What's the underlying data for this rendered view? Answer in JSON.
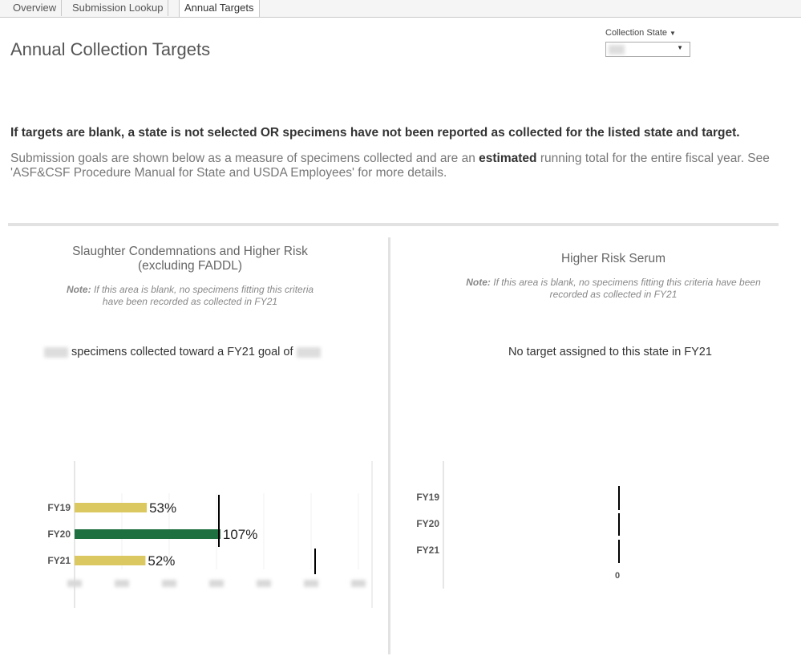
{
  "tabs": [
    {
      "label": "Overview"
    },
    {
      "label": "Submission Lookup"
    },
    {
      "label": "Annual Targets"
    }
  ],
  "page_title": "Annual Collection Targets",
  "filter": {
    "label": "Collection State",
    "value": ""
  },
  "notice": "If targets are blank, a state is not selected OR specimens have not been reported as collected for the listed state and target.",
  "description": {
    "before": "Submission goals are shown below as a measure of specimens collected and are an ",
    "emphasis": "estimated",
    "after": " running total for the entire fiscal year. See 'ASF&CSF Procedure Manual for State and USDA Employees' for more details."
  },
  "left_panel": {
    "title_line1": "Slaughter Condemnations and Higher Risk",
    "title_line2": "(excluding FADDL)",
    "note_label": "Note:",
    "note_line1": " If this area is blank, no specimens fitting this criteria",
    "note_line2": "have been recorded as collected in FY21",
    "summary_text": "specimens collected toward a FY21 goal of"
  },
  "right_panel": {
    "title": "Higher Risk Serum",
    "note_label": "Note:",
    "note_line1": " If this area is blank, no specimens fitting this criteria have been",
    "note_line2": "recorded as collected in FY21",
    "summary_text": "No target assigned to this state in FY21"
  },
  "colors": {
    "bar_default": "#dcc860",
    "bar_highlight": "#1e7040",
    "target_line": "#000000"
  },
  "chart_data": [
    {
      "type": "bar",
      "orientation": "horizontal",
      "categories": [
        "FY19",
        "FY20",
        "FY21"
      ],
      "values": [
        53,
        107,
        52
      ],
      "value_unit": "percent of goal",
      "data_labels": [
        "53%",
        "107%",
        "52%"
      ],
      "highlighted_category": "FY20"
    },
    {
      "type": "bar",
      "orientation": "horizontal",
      "categories": [
        "FY19",
        "FY20",
        "FY21"
      ],
      "values": [
        0,
        0,
        0
      ],
      "x_tick_labels": [
        "0"
      ]
    }
  ]
}
